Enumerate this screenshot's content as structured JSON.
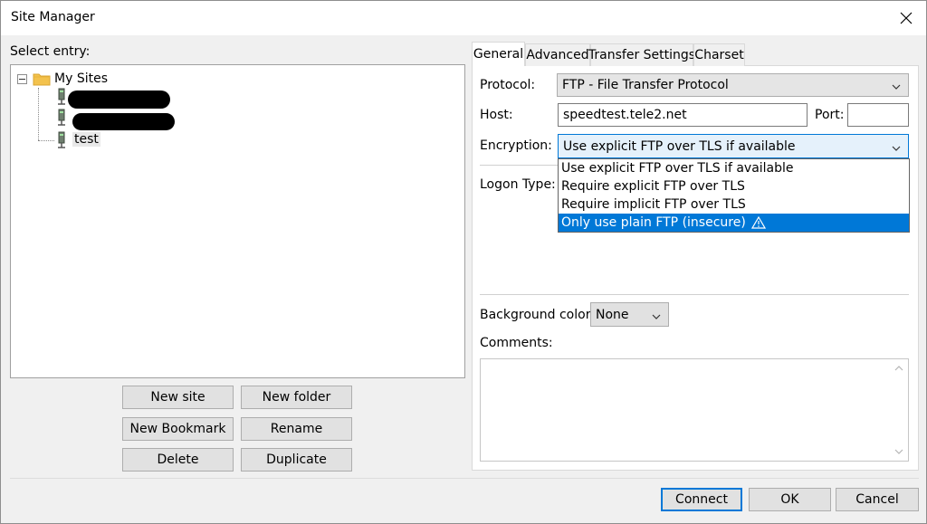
{
  "window": {
    "title": "Site Manager"
  },
  "left": {
    "select_label": "Select entry:",
    "tree": {
      "root_label": "My Sites",
      "items": [
        {
          "label": ""
        },
        {
          "label": ""
        },
        {
          "label": "test"
        }
      ]
    },
    "buttons": {
      "new_site": "New site",
      "new_folder": "New folder",
      "new_bookmark": "New Bookmark",
      "rename": "Rename",
      "delete": "Delete",
      "duplicate": "Duplicate"
    }
  },
  "tabs": [
    {
      "label": "General",
      "active": true
    },
    {
      "label": "Advanced",
      "active": false
    },
    {
      "label": "Transfer Settings",
      "active": false
    },
    {
      "label": "Charset",
      "active": false
    }
  ],
  "general": {
    "protocol_label": "Protocol:",
    "protocol_value": "FTP - File Transfer Protocol",
    "host_label": "Host:",
    "host_value": "speedtest.tele2.net",
    "port_label": "Port:",
    "port_value": "",
    "encryption_label": "Encryption:",
    "encryption_value": "Use explicit FTP over TLS if available",
    "encryption_options": [
      "Use explicit FTP over TLS if available",
      "Require explicit FTP over TLS",
      "Require implicit FTP over TLS",
      "Only use plain FTP (insecure)"
    ],
    "encryption_highlighted_index": 3,
    "logon_type_label": "Logon Type:",
    "background_color_label": "Background color:",
    "background_color_value": "None",
    "comments_label": "Comments:",
    "comments_value": ""
  },
  "footer": {
    "connect": "Connect",
    "ok": "OK",
    "cancel": "Cancel"
  },
  "colors": {
    "accent": "#0078d7",
    "folder": "#f3c24d"
  }
}
